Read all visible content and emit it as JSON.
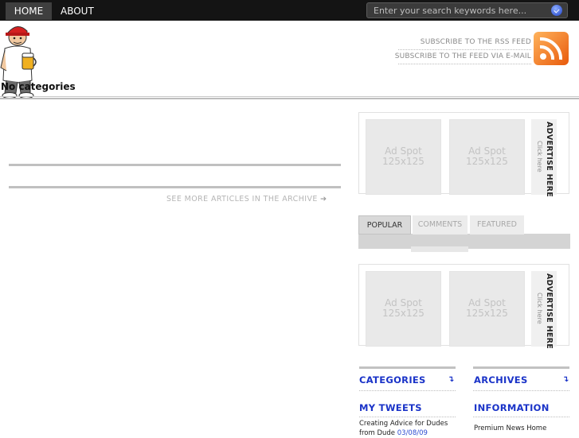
{
  "nav": {
    "home": "HOME",
    "about": "ABOUT"
  },
  "search": {
    "placeholder": "Enter your search keywords here..."
  },
  "header": {
    "categories_label": "No categories",
    "rss_subscribe": "SUBSCRIBE TO THE RSS FEED",
    "email_subscribe": "SUBSCRIBE TO THE FEED VIA E-MAIL"
  },
  "main": {
    "archive_link": "SEE MORE ARTICLES IN THE ARCHIVE",
    "archive_arrow": "➔"
  },
  "ads": [
    {
      "spots": [
        {
          "line1": "Ad Spot",
          "line2": "125x125"
        },
        {
          "line1": "Ad Spot",
          "line2": "125x125"
        }
      ],
      "advertise": "ADVERTISE HERE",
      "click": "Click here"
    },
    {
      "spots": [
        {
          "line1": "Ad Spot",
          "line2": "125x125"
        },
        {
          "line1": "Ad Spot",
          "line2": "125x125"
        }
      ],
      "advertise": "ADVERTISE HERE",
      "click": "Click here"
    }
  ],
  "tabs": {
    "popular": "POPULAR",
    "comments": "COMMENTS",
    "featured": "FEATURED"
  },
  "sidebar": {
    "categories": "CATEGORIES",
    "archives": "ARCHIVES",
    "my_tweets": "MY TWEETS",
    "information": "INFORMATION",
    "expand_arrow": "↴",
    "tweet_text": "Creating Advice for Dudes from Dude",
    "tweet_date": "03/08/09",
    "info_item": "Premium News Home"
  },
  "colors": {
    "topbar": "#141414",
    "accent_link": "#1a33c8",
    "rss_orange": "#e85a0c"
  }
}
